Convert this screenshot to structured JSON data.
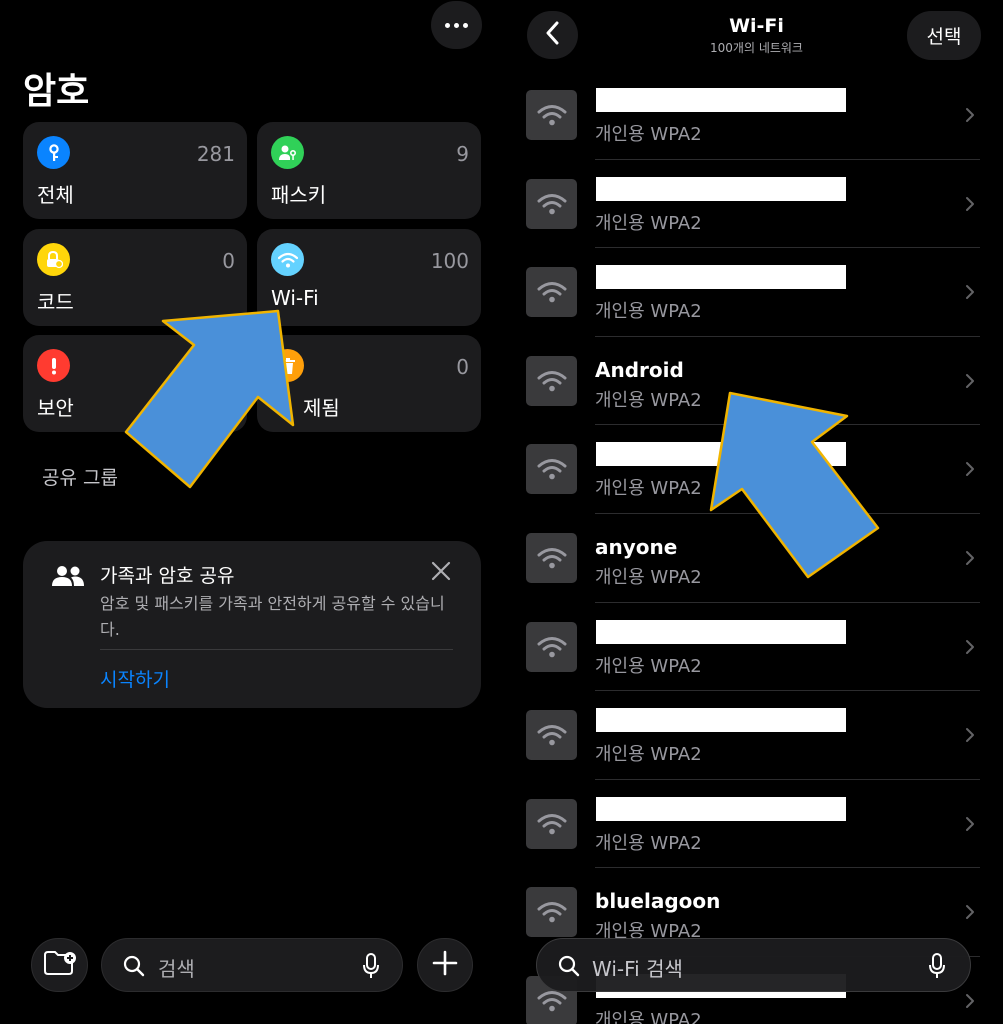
{
  "passwords": {
    "title": "암호",
    "categories": [
      {
        "label": "전체",
        "count": "281",
        "icon": "key-icon",
        "color": "#0a84ff"
      },
      {
        "label": "패스키",
        "count": "9",
        "icon": "person-key-icon",
        "color": "#30d158"
      },
      {
        "label": "코드",
        "count": "0",
        "icon": "lock-clock-icon",
        "color": "#ffd60a"
      },
      {
        "label": "Wi-Fi",
        "count": "100",
        "icon": "wifi-icon",
        "color": "#64d2ff"
      },
      {
        "label": "보안",
        "count": "",
        "icon": "exclamation-icon",
        "color": "#ff3b30"
      },
      {
        "label": "제됨",
        "count": "0",
        "icon": "trash-icon",
        "color": "#ff9f0a"
      }
    ],
    "section_label": "공유 그룹",
    "share_card": {
      "title": "가족과 암호 공유",
      "description": "암호 및 패스키를 가족과 안전하게 공유할 수 있습니다.",
      "action": "시작하기"
    },
    "search": {
      "placeholder": "검색"
    }
  },
  "wifi": {
    "title": "Wi-Fi",
    "subtitle": "100개의 네트워크",
    "select_label": "선택",
    "networks": [
      {
        "name": "",
        "redacted": true,
        "security": "개인용 WPA2"
      },
      {
        "name": "",
        "redacted": true,
        "security": "개인용 WPA2"
      },
      {
        "name": "",
        "redacted": true,
        "security": "개인용 WPA2"
      },
      {
        "name": "Android",
        "redacted": false,
        "security": "개인용 WPA2"
      },
      {
        "name": "",
        "redacted": true,
        "security": "개인용 WPA2"
      },
      {
        "name": "anyone",
        "redacted": false,
        "security": "개인용 WPA2"
      },
      {
        "name": "",
        "redacted": true,
        "security": "개인용 WPA2"
      },
      {
        "name": "",
        "redacted": true,
        "security": "개인용 WPA2"
      },
      {
        "name": "",
        "redacted": true,
        "security": "개인용 WPA2"
      },
      {
        "name": "bluelagoon",
        "redacted": false,
        "security": "개인용 WPA2"
      },
      {
        "name": "",
        "redacted": true,
        "security": "개인용 WPA2"
      }
    ],
    "search": {
      "placeholder": "Wi-Fi 검색"
    }
  },
  "colors": {
    "accent": "#0a84ff",
    "card_bg": "#1c1c1e",
    "annotation_arrow": "#4a90d9",
    "annotation_outline": "#f0b400"
  }
}
